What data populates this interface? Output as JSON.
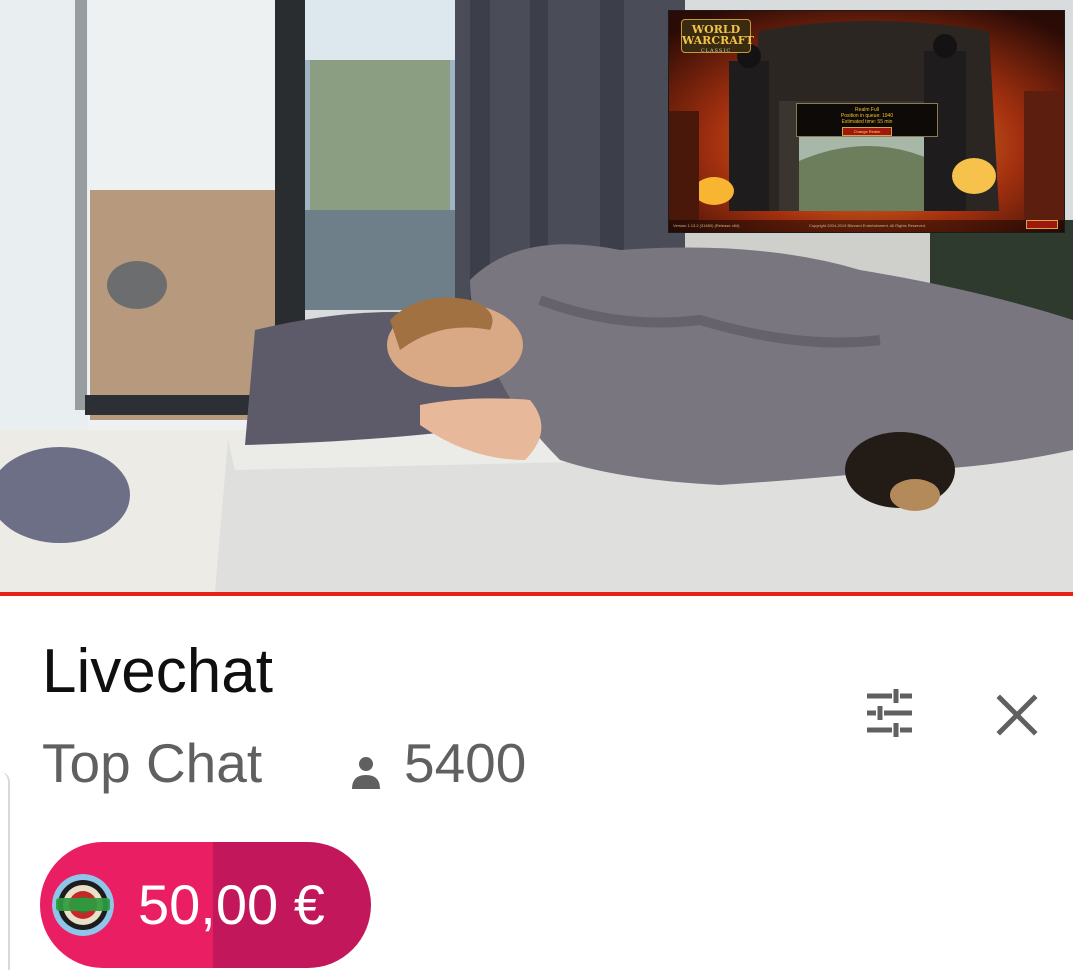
{
  "video": {
    "overlay": {
      "logo_title": "WORLD WARCRAFT",
      "logo_subtitle": "CLASSIC",
      "dialog_line1": "Realm Full",
      "dialog_line2": "Position in queue: 1940",
      "dialog_line3": "Estimated time: 55 min",
      "dialog_button": "Change Realm",
      "footer_left": "Version 1.13.2 (31650) (Release x64)",
      "footer_center": "Copyright 2004-2019 Blizzard Entertainment. All Rights Reserved."
    },
    "progress_fraction": 1.0,
    "accent_color": "#e62117"
  },
  "chat": {
    "title": "Livechat",
    "mode": "Top Chat",
    "viewer_count": "5400",
    "icons": {
      "viewers": "person-icon",
      "filter": "sliders-icon",
      "close": "close-icon"
    }
  },
  "superchat": {
    "amount": "50,00 €",
    "avatar": "dartboard-avatar-icon",
    "color_primary": "#e91e63",
    "color_secondary": "#c2185b"
  }
}
